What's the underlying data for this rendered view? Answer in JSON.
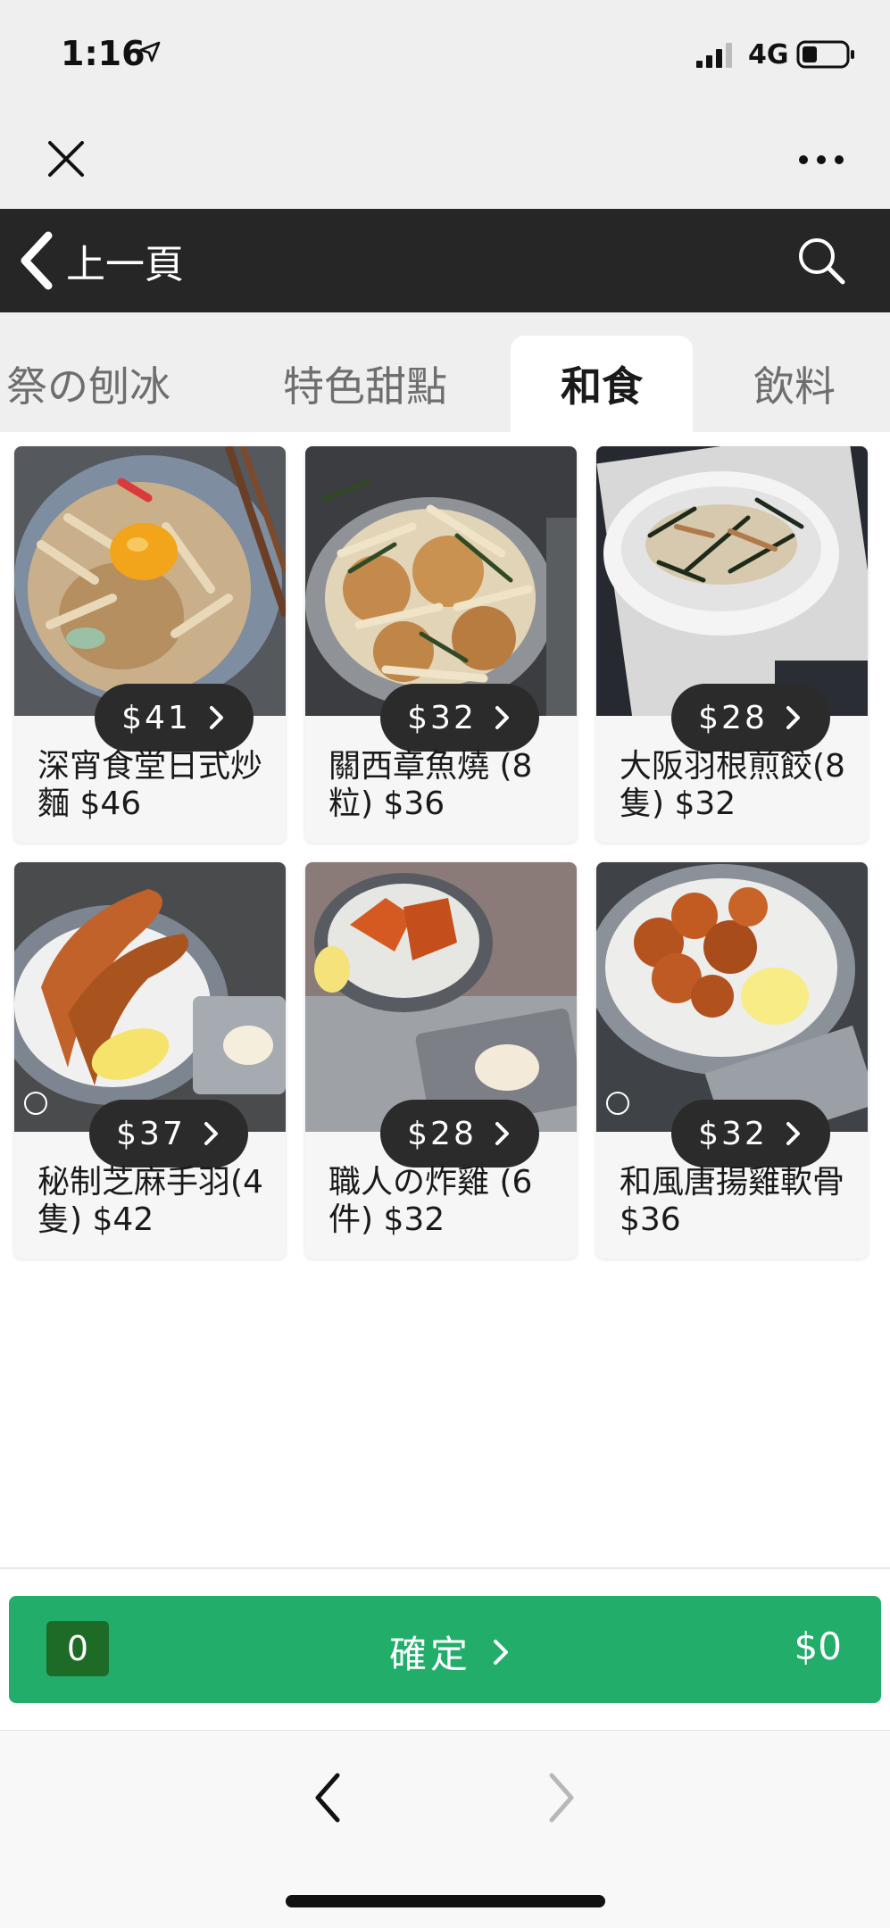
{
  "status_bar": {
    "time": "1:16",
    "network": "4G",
    "icons": [
      "location-arrow-icon",
      "signal-icon",
      "battery-icon"
    ]
  },
  "top_bar": {
    "icons": [
      "close-icon",
      "more-dots-icon"
    ]
  },
  "nav": {
    "back_label": "上一頁",
    "icons": [
      "chevron-left-icon",
      "search-icon"
    ]
  },
  "tabs": [
    {
      "label": "祭の刨冰",
      "active": false
    },
    {
      "label": "特色甜點",
      "active": false
    },
    {
      "label": "和食",
      "active": true
    },
    {
      "label": "飲料",
      "active": false
    }
  ],
  "products": [
    {
      "price": "$41",
      "name": "深宵食堂日式炒麵 $46"
    },
    {
      "price": "$32",
      "name": "關西章魚燒 (8粒) $36"
    },
    {
      "price": "$28",
      "name": "大阪羽根煎餃(8隻) $32"
    },
    {
      "price": "$37",
      "name": "秘制芝麻手羽(4隻) $42"
    },
    {
      "price": "$28",
      "name": "職人の炸雞 (6件) $32"
    },
    {
      "price": "$32",
      "name": "和風唐揚雞軟骨 $36"
    }
  ],
  "cart": {
    "quantity": "0",
    "confirm_label": "確定",
    "total": "$0"
  },
  "colors": {
    "nav_bg": "#262626",
    "tab_bg": "#efefef",
    "confirm_green": "#22ad6a",
    "badge_green": "#1d6b27",
    "pill_bg": "#2b2b2b"
  }
}
